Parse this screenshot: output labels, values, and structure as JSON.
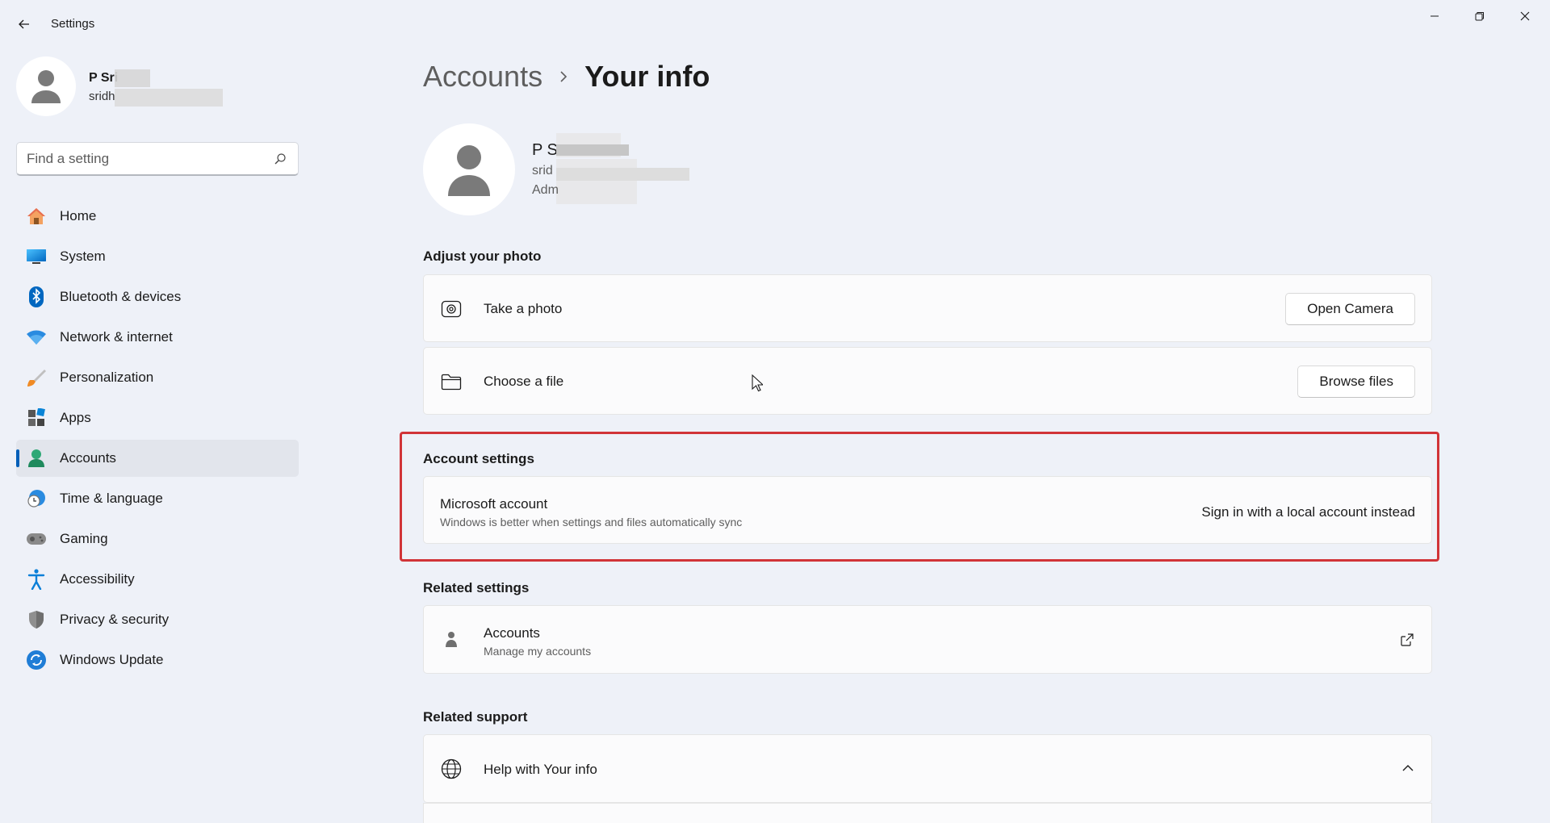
{
  "window": {
    "title": "Settings"
  },
  "profile": {
    "name": "P Sri",
    "email": "sridh"
  },
  "search": {
    "placeholder": "Find a setting"
  },
  "nav": {
    "items": [
      {
        "label": "Home",
        "icon": "home-icon"
      },
      {
        "label": "System",
        "icon": "system-icon"
      },
      {
        "label": "Bluetooth & devices",
        "icon": "bluetooth-icon"
      },
      {
        "label": "Network & internet",
        "icon": "wifi-icon"
      },
      {
        "label": "Personalization",
        "icon": "brush-icon"
      },
      {
        "label": "Apps",
        "icon": "apps-icon"
      },
      {
        "label": "Accounts",
        "icon": "accounts-icon",
        "active": true
      },
      {
        "label": "Time & language",
        "icon": "clock-globe-icon"
      },
      {
        "label": "Gaming",
        "icon": "gamepad-icon"
      },
      {
        "label": "Accessibility",
        "icon": "accessibility-icon"
      },
      {
        "label": "Privacy & security",
        "icon": "shield-icon"
      },
      {
        "label": "Windows Update",
        "icon": "update-icon"
      }
    ]
  },
  "breadcrumb": {
    "parent": "Accounts",
    "current": "Your info"
  },
  "user_header": {
    "name": "P S",
    "email": "srid",
    "role": "Adm"
  },
  "adjust_photo": {
    "title": "Adjust your photo",
    "take_photo": {
      "label": "Take a photo",
      "button": "Open Camera"
    },
    "choose_file": {
      "label": "Choose a file",
      "button": "Browse files"
    }
  },
  "account_settings": {
    "title": "Account settings",
    "ms_account_title": "Microsoft account",
    "ms_account_sub": "Windows is better when settings and files automatically sync",
    "link": "Sign in with a local account instead",
    "highlight_color": "#d13438"
  },
  "related_settings": {
    "title": "Related settings",
    "accounts_title": "Accounts",
    "accounts_sub": "Manage my accounts"
  },
  "related_support": {
    "title": "Related support",
    "help_label": "Help with Your info"
  },
  "colors": {
    "accent": "#005fb8",
    "background": "#eef1f8"
  }
}
